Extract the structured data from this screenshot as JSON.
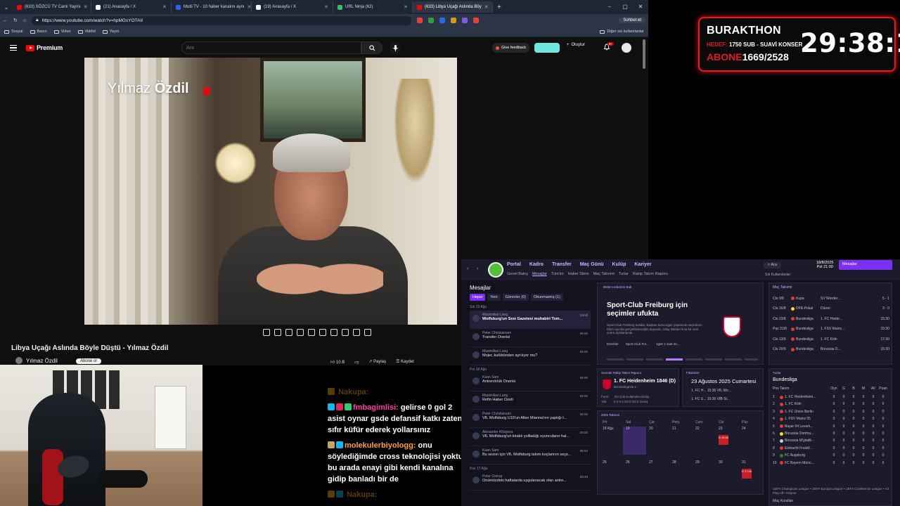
{
  "browser": {
    "tabs": [
      {
        "label": "(633) SÖZCÜ TV Canlı Yayını",
        "fav": "#ff0000"
      },
      {
        "label": "(21) Anasayfa / X",
        "fav": "#ffffff"
      },
      {
        "label": "Multi TV - 10 haber kanalını aynı",
        "fav": "#2a62ff"
      },
      {
        "label": "(19) Anasayfa / X",
        "fav": "#ffffff"
      },
      {
        "label": "URL Ninja (62)",
        "fav": "#37c16b"
      },
      {
        "label": "(633) Libya Uçağı Aslında Böy",
        "fav": "#ff0000"
      }
    ],
    "url": "https://www.youtube.com/watch?v=hpMGsYOTAII",
    "chat_button": "Sohbet et",
    "bookmarks": [
      "Sosyal",
      "Basın",
      "Video",
      "Viddid",
      "Yayın"
    ],
    "other_bookmarks": "Diğer sık kullanılanlar"
  },
  "youtube": {
    "logo": "Premium",
    "search_placeholder": "Ara",
    "feedback": "Give feedback",
    "create": "Oluştur",
    "notif_count": "9+",
    "video_name_light": "Yılmaz",
    "video_name_bold": "Özdil",
    "title": "Libya Uçağı Aslında Böyle Düştü - Yılmaz Özdil",
    "channel": "Yılmaz Özdil",
    "subscribe": "Abone ol",
    "likes": "10 B",
    "share": "Paylaş",
    "save": "Kaydet"
  },
  "overlay": {
    "title": "BURAKTHON",
    "goal_label": "HEDEF:",
    "goal_text": "1750 SUB - SUAVİ KONSER",
    "subs_label": "ABONE",
    "subs_value": "1669/2528",
    "timer": "29:38:13"
  },
  "chat": [
    {
      "name": "Nakupa:",
      "text": "",
      "faded": true,
      "name_color": "#f4b400"
    },
    {
      "name": "fmbagimlisi:",
      "text": "gelirse 0 gol 2 asist oynar gsde defansif katkı zaten sıfır küfür ederek yollarsınız",
      "faded": false,
      "name_color": "#ff3fa4"
    },
    {
      "name": "molekulerbiyologg:",
      "text": "onu söylediğimde cross teknolojisi yoktu bu arada enayi gibi kendi kanalına gidip banladı bir de",
      "faded": false,
      "name_color": "#ff9f2e"
    },
    {
      "name": "Nakupa:",
      "text": "",
      "faded": true,
      "name_color": "#f4b400"
    }
  ],
  "fm": {
    "nav": [
      "Portal",
      "Kadro",
      "Transfer",
      "Maç Günü",
      "Kulüp",
      "Kariyer"
    ],
    "subnav": [
      "Genel Bakış",
      "Mesajlar",
      "Tüm'im",
      "Haber Sitesi",
      "Maç Takvimi",
      "Turlar",
      "Rakip Takım Raporu"
    ],
    "search": "Ara",
    "date_line1": "18/8/2025",
    "date_line2": "Pzt  21:00",
    "messages_button": "Mesajlar",
    "shortcuts": "Sık Kullanılanlar",
    "inbox_title": "Mesajlar",
    "inbox_tabs": [
      "Hepsi",
      "Yeni",
      "Görevler (0)",
      "Okunmamış (1)"
    ],
    "inbox_groups": [
      {
        "date": "Sal 19 Ağu",
        "items": [
          {
            "from": "Maximilian Lang",
            "subject": "Wolfsburg'un Sesi Gazetesi muhabiri Tom...",
            "time": "Şimdi",
            "sel": true
          },
          {
            "from": "Peter Christiansen",
            "subject": "Transfer Önerisi",
            "time": "09:00",
            "sel": false
          },
          {
            "from": "Maximilian Lang",
            "subject": "Mojer, kulübünden ayrılıyor mu?",
            "time": "09:00",
            "sel": false
          }
        ]
      },
      {
        "date": "Pzt 18 Ağu",
        "items": [
          {
            "from": "Kaan Sam",
            "subject": "Antrenörlük Önerisi",
            "time": "09:00",
            "sel": false
          },
          {
            "from": "Maximilian Lang",
            "subject": "Refin Haber Özeti",
            "time": "09:00",
            "sel": false
          },
          {
            "from": "Peter Christiansen",
            "subject": "VfL Wolfsburg U19'un Allen Mianna'nın yaptığı t...",
            "time": "09:00",
            "sel": false
          },
          {
            "from": "Alexander Klitzpera",
            "subject": "VfL Wolfsburg'un kiralık yollladığı oyuncuların hal...",
            "time": "09:00",
            "sel": false
          },
          {
            "from": "Kaan Sam",
            "subject": "Bu sezon için VfL Wolfsburg takım koçlarının seçe...",
            "time": "08:53",
            "sel": false
          }
        ]
      },
      {
        "date": "Paz 17 Ağu",
        "items": [
          {
            "from": "Peter Ostrup",
            "subject": "Önümüzdeki haftalarda uygulanacak olan antre...",
            "time": "09:49",
            "sel": false
          }
        ]
      }
    ],
    "news_tag": "Bütün Haberleri Bak",
    "news_headline": "Sport-Club Freiburg için seçimler ufukta",
    "news_body": "Sport-Club Freiburg kulübü, Başkan kurucuğun yapılacak seçimlerin Ekim ayında gerçekleşeceğini duyurdu. Aday listeleri kısa bir süre sonra açıklanacak.",
    "news_foot": [
      "Ereekler",
      "Sport-Club Fre...",
      "1gün 1 saat ön..."
    ],
    "fixtures_hdr": "Maç Takvimi",
    "fixtures": [
      {
        "date": "Cts 9/8",
        "comp": "Kupa",
        "opp": "SV Werder...",
        "res": "5 - 1",
        "color": "#e53935"
      },
      {
        "date": "Cts 16/8",
        "comp": "DFB-Pokal",
        "opp": "Düren",
        "res": "3 - 0",
        "color": "#fdd835"
      },
      {
        "date": "Cts 23/8",
        "comp": "Bundesliga",
        "opp": "1. FC Heide...",
        "res": "15:30",
        "color": "#e53935"
      },
      {
        "date": "Paz 31/8",
        "comp": "Bundesliga",
        "opp": "1. FSV Mainz...",
        "res": "15:30",
        "color": "#e53935"
      },
      {
        "date": "Cts 13/9",
        "comp": "Bundesliga",
        "opp": "1. FC Köln",
        "res": "17:30",
        "color": "#e53935"
      },
      {
        "date": "Cts 20/9",
        "comp": "Bundesliga",
        "opp": "Borussia D...",
        "res": "15:30",
        "color": "#e53935"
      }
    ],
    "opp_hdr": "Sonraki Rakip Takım Raporu",
    "opp_team": "1. FC Heidenheim 1846 (D)",
    "opp_league": "Bundesliga'da 1.",
    "opp_form": "Form       En Çok Kullanılan Diziliş\nYok        4-2-3-1 DCS DCS Geniş",
    "next_hdr": "Fikstürler",
    "next_date": "23 Ağustos 2025 Cumartesi",
    "next_rows": [
      "1. FC H...   15:30   VfL Wo...",
      "1. FC U...   15:30   VfB St..."
    ],
    "table_hdr": "Turlar",
    "table_title": "Bundesliga",
    "table_cols": [
      "Pos",
      "Takım",
      "Oyn",
      "G",
      "B",
      "M",
      "AV",
      "Puan"
    ],
    "table_rows": [
      {
        "p": "1",
        "n": "1. FC Heidenheim...",
        "c": "#e53935"
      },
      {
        "p": "2",
        "n": "1. FC Köln",
        "c": "#e53935"
      },
      {
        "p": "3",
        "n": "1. FC Union Berlin",
        "c": "#e53935"
      },
      {
        "p": "4",
        "n": "1. FSV Mainz 05",
        "c": "#e53935"
      },
      {
        "p": "5",
        "n": "Bayer 04 Leverk...",
        "c": "#e53935"
      },
      {
        "p": "6",
        "n": "Borussia Dortmu...",
        "c": "#fdd835"
      },
      {
        "p": "7",
        "n": "Borussia M'gladb...",
        "c": "#cccccc"
      },
      {
        "p": "8",
        "n": "Eintracht Frankf...",
        "c": "#e53935"
      },
      {
        "p": "9",
        "n": "FC Augsburg",
        "c": "#2e7d32"
      },
      {
        "p": "10",
        "n": "FC Bayern Münc...",
        "c": "#e53935"
      }
    ],
    "table_foot": "UEFA Champions League  •  UEFA Europa League  •  UEFA Conference League  •  Alt Play-off  •  Düşme",
    "table_link": "Maç Kuralları",
    "cal_hdr": "2025 Takvimi",
    "cal_days": [
      "Prt",
      "Sal",
      "Çar",
      "Perş",
      "Cum",
      "Cts",
      "Paz"
    ],
    "cal_week1": [
      "18 Ağu",
      "19",
      "20",
      "21",
      "22",
      "23",
      "24"
    ],
    "cal_week2": [
      "25",
      "26",
      "27",
      "28",
      "29",
      "30",
      "31"
    ],
    "cal_event1": "D 15:30",
    "cal_event2": "E 17:30"
  }
}
